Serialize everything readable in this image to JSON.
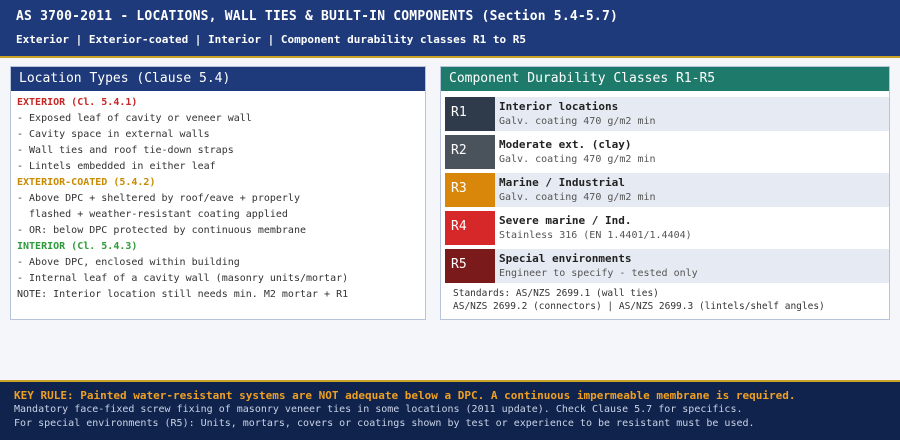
{
  "header": {
    "title": "AS 3700-2011 - LOCATIONS, WALL TIES & BUILT-IN COMPONENTS (Section 5.4-5.7)",
    "subtitle": "Exterior | Exterior-coated | Interior | Component durability classes R1 to R5"
  },
  "locations": {
    "title": "Location Types (Clause 5.4)",
    "exterior": {
      "heading": "EXTERIOR (Cl. 5.4.1)",
      "lines": [
        "- Exposed leaf of cavity or veneer wall",
        "- Cavity space in external walls",
        "- Wall ties and roof tie-down straps",
        "- Lintels embedded in either leaf"
      ]
    },
    "coated": {
      "heading": "EXTERIOR-COATED (5.4.2)",
      "lines": [
        "- Above DPC + sheltered by roof/eave + properly",
        "  flashed + weather-resistant coating applied",
        "- OR: below DPC protected by continuous membrane"
      ]
    },
    "interior": {
      "heading": "INTERIOR (Cl. 5.4.3)",
      "lines": [
        "- Above DPC, enclosed within building",
        "- Internal leaf of a cavity wall (masonry units/mortar)"
      ]
    },
    "note": "NOTE: Interior location still needs min. M2 mortar + R1"
  },
  "classes": {
    "title": "Component Durability Classes R1-R5",
    "rows": [
      {
        "code": "R1",
        "title": "Interior locations",
        "spec": "Galv. coating 470 g/m2 min",
        "color": "#2f3a4a"
      },
      {
        "code": "R2",
        "title": "Moderate ext. (clay)",
        "spec": "Galv. coating 470 g/m2 min",
        "color": "#4a525c"
      },
      {
        "code": "R3",
        "title": "Marine / Industrial",
        "spec": "Galv. coating 470 g/m2 min",
        "color": "#d9870a"
      },
      {
        "code": "R4",
        "title": "Severe marine / Ind.",
        "spec": "Stainless 316 (EN 1.4401/1.4404)",
        "color": "#d62828"
      },
      {
        "code": "R5",
        "title": "Special environments",
        "spec": "Engineer to specify - tested only",
        "color": "#7a1a1a"
      }
    ],
    "standards_1": "Standards: AS/NZS 2699.1 (wall ties)",
    "standards_2": "AS/NZS 2699.2 (connectors) | AS/NZS 2699.3 (lintels/shelf angles)"
  },
  "footer": {
    "key_rule": "KEY RULE: Painted water-resistant systems are NOT adequate below a DPC. A continuous impermeable membrane is required.",
    "line_1": "Mandatory face-fixed screw fixing of masonry veneer ties in some locations (2011 update). Check Clause 5.7 for specifics.",
    "line_2": "For special environments (R5): Units, mortars, covers or coatings shown by test or experience to be resistant must be used."
  }
}
